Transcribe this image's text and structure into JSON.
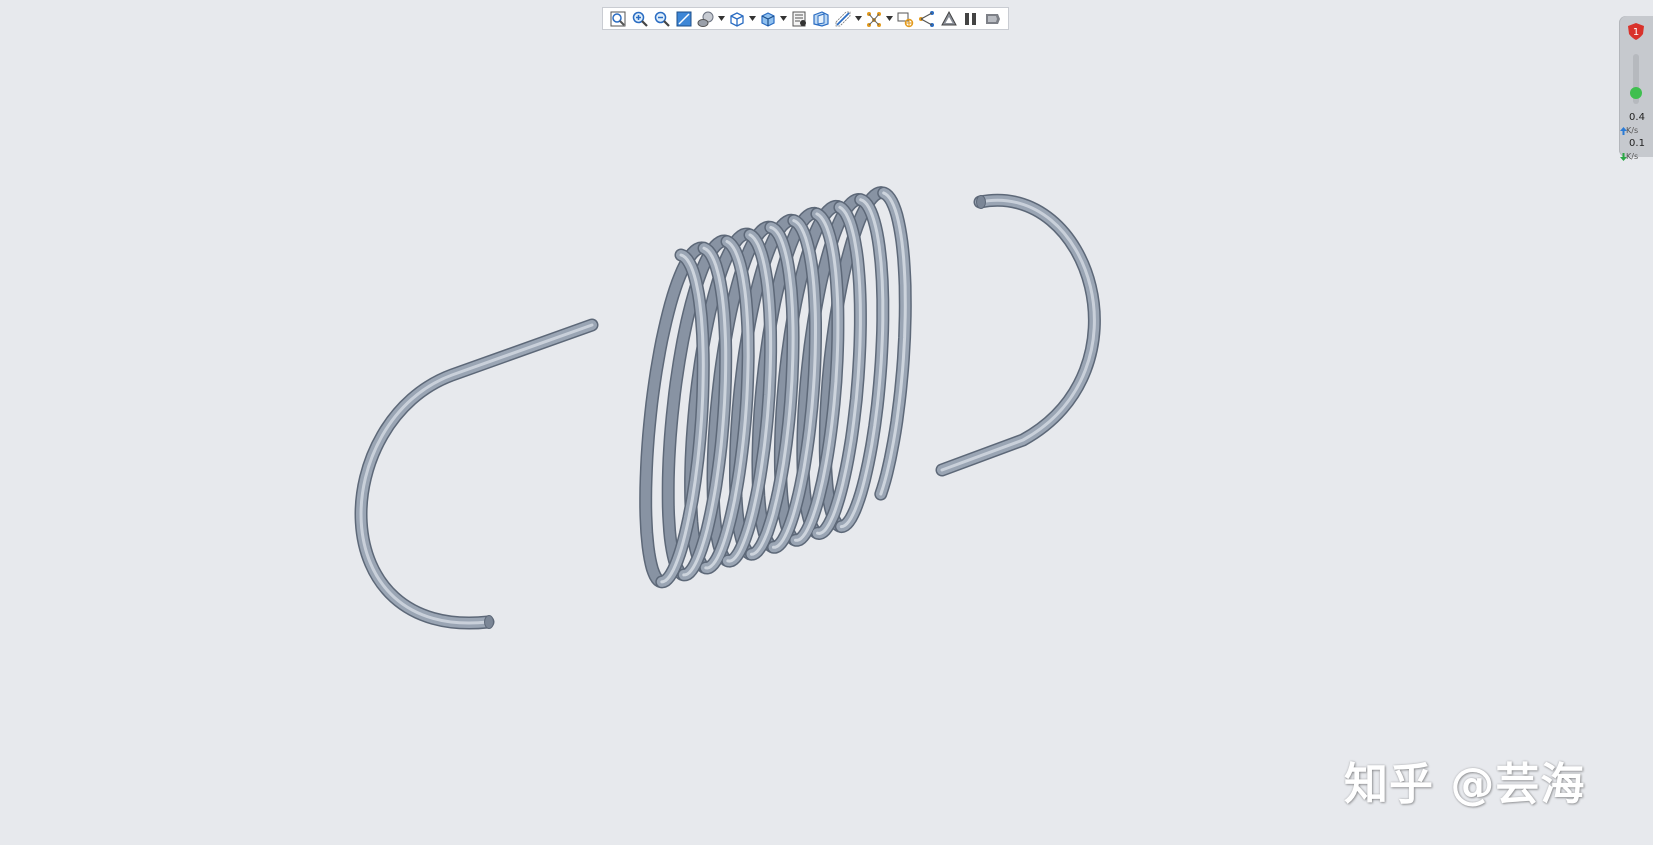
{
  "colors": {
    "background": "#e7e9ed",
    "spring_steel": "#9aa5b4",
    "spring_edge": "#5d6878",
    "toolbar_bg": "#ffffff",
    "netmon_bg": "#c6c9ce",
    "netmon_led": "#3fbf4f",
    "badge_red": "#d9322b"
  },
  "toolbar": {
    "items": [
      {
        "icon": "zoom-fit-icon"
      },
      {
        "icon": "zoom-in-icon"
      },
      {
        "icon": "zoom-out-icon"
      },
      {
        "icon": "refit-icon"
      },
      {
        "icon": "display-style-icon",
        "dropdown": true
      },
      {
        "icon": "saved-views-icon",
        "dropdown": true
      },
      {
        "icon": "view-orientation-icon",
        "dropdown": true
      },
      {
        "icon": "view-manager-icon"
      },
      {
        "icon": "perspective-icon"
      },
      {
        "icon": "datum-display-icon",
        "dropdown": true
      },
      {
        "icon": "annotation-display-icon",
        "dropdown": true
      },
      {
        "icon": "spin-center-icon"
      },
      {
        "icon": "model-tree-icon"
      },
      {
        "icon": "appearance-icon"
      },
      {
        "icon": "pause-icon"
      },
      {
        "icon": "flag-icon"
      }
    ]
  },
  "network_monitor": {
    "badge": "1",
    "upload_value": "0.4",
    "upload_unit": "K/s",
    "download_value": "0.1",
    "download_unit": "K/s"
  },
  "watermark": {
    "text": "知乎 @芸海"
  }
}
